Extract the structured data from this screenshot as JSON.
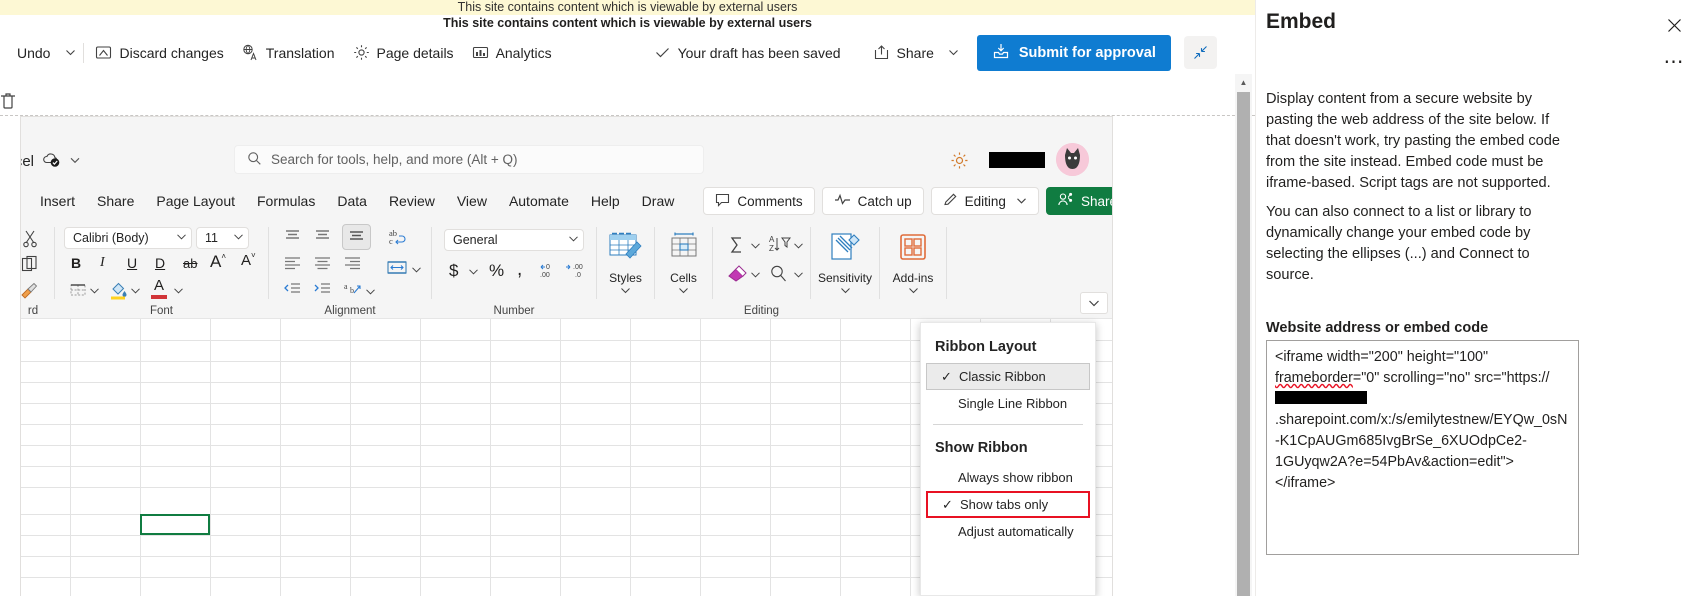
{
  "banner": {
    "line1": "This site contains content which is viewable by external users",
    "line2": "This site contains content which is viewable by external users"
  },
  "command_bar": {
    "undo_label": "Undo",
    "discard_label": "Discard changes",
    "translation_label": "Translation",
    "page_details_label": "Page details",
    "analytics_label": "Analytics",
    "save_status": "Your draft has been saved",
    "share_label": "Share",
    "submit_label": "Submit for approval"
  },
  "excel": {
    "app_name": "excel",
    "search_placeholder": "Search for tools, help, and more (Alt + Q)",
    "tabs": [
      {
        "label": "Insert"
      },
      {
        "label": "Share"
      },
      {
        "label": "Page Layout"
      },
      {
        "label": "Formulas"
      },
      {
        "label": "Data"
      },
      {
        "label": "Review"
      },
      {
        "label": "View"
      },
      {
        "label": "Automate"
      },
      {
        "label": "Help"
      },
      {
        "label": "Draw"
      }
    ],
    "right_buttons": [
      {
        "label": "Comments",
        "icon": "comment-icon"
      },
      {
        "label": "Catch up",
        "icon": "activity-icon"
      },
      {
        "label": "Editing",
        "icon": "pencil-icon"
      },
      {
        "label": "Share",
        "icon": "people-share-icon"
      }
    ],
    "ribbon": {
      "font_name": "Calibri (Body)",
      "font_size": "11",
      "number_format": "General",
      "groups": [
        {
          "label": "rd"
        },
        {
          "label": "Font"
        },
        {
          "label": "Alignment"
        },
        {
          "label": "Number"
        },
        {
          "label": "Editing"
        },
        {
          "label": "Sensitivity"
        },
        {
          "label": "Add-ins"
        }
      ],
      "styles_label": "Styles",
      "cells_label": "Cells",
      "sensitivity_label": "Sensitivity",
      "addins_label": "Add-ins",
      "bold": "B",
      "italic": "I",
      "underline": "U",
      "double_underline": "D",
      "strikethrough": "ab",
      "grow_font": "A",
      "shrink_font": "A",
      "currency": "$",
      "percent": "%",
      "comma": ",",
      "font_color_letter": "A"
    }
  },
  "ribbon_menu": {
    "heading_layout": "Ribbon Layout",
    "layout_items": [
      {
        "label": "Classic Ribbon",
        "checked": true,
        "selected": true
      },
      {
        "label": "Single Line Ribbon",
        "checked": false,
        "selected": false
      }
    ],
    "heading_show": "Show Ribbon",
    "show_items": [
      {
        "label": "Always show ribbon",
        "checked": false,
        "highlighted": false
      },
      {
        "label": "Show tabs only",
        "checked": true,
        "highlighted": true
      },
      {
        "label": "Adjust automatically",
        "checked": false,
        "highlighted": false
      }
    ],
    "highlight_color": "#e81123"
  },
  "panel": {
    "title": "Embed",
    "close_icon": "close-icon",
    "more_icon": "ellipsis-icon",
    "paragraph1": "Display content from a secure website by pasting the web address of the site below. If that doesn't work, try pasting the embed code from the site instead. Embed code must be iframe-based. Script tags are not supported.",
    "paragraph2": "You can also connect to a list or library to dynamically change your embed code by selecting the ellipses (...) and Connect to source.",
    "field_label": "Website address or embed code",
    "embed_code_part1": "<iframe width=\"200\" height=\"100\" ",
    "embed_code_frameborder": "frameborder",
    "embed_code_part2": "=\"0\" scrolling=\"no\" src=\"https://",
    "embed_code_part3": ".sharepoint.com/x:/s/emilytestnew/EYQw_0sN-K1CpAUGm685IvgBrSe_6XUOdpCe2-1GUyqw2A?e=54PbAv&action=edit\"></iframe>"
  },
  "colors": {
    "banner_yellow": "#fdf8d4",
    "primary_blue": "#0f7cd1",
    "excel_green": "#107c41",
    "highlight_red": "#e81123"
  }
}
